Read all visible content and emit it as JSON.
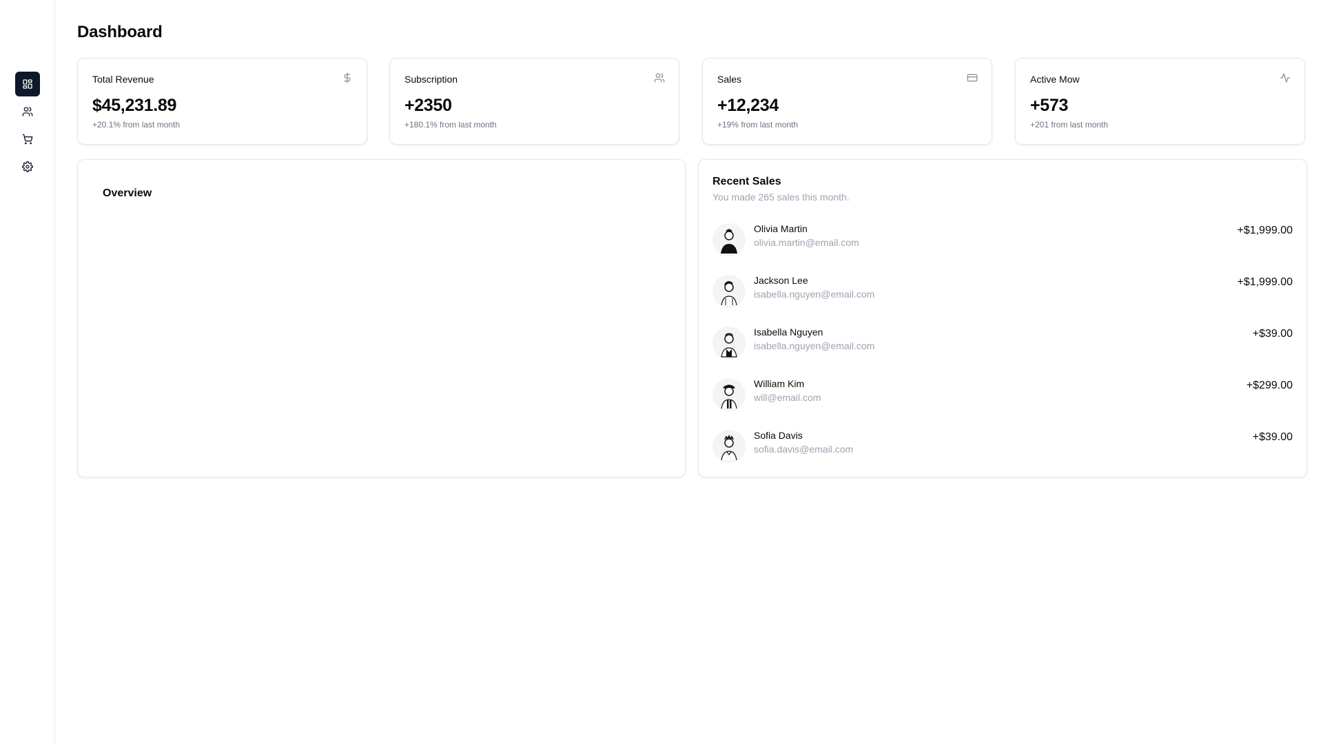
{
  "page": {
    "title": "Dashboard"
  },
  "sidebar": {
    "items": [
      {
        "icon": "dashboard-icon",
        "active": true
      },
      {
        "icon": "users-icon",
        "active": false
      },
      {
        "icon": "cart-icon",
        "active": false
      },
      {
        "icon": "settings-icon",
        "active": false
      }
    ]
  },
  "stats": [
    {
      "label": "Total Revenue",
      "value": "$45,231.89",
      "sub": "+20.1% from last month",
      "icon": "dollar-icon"
    },
    {
      "label": "Subscription",
      "value": "+2350",
      "sub": "+180.1% from last month",
      "icon": "users-icon"
    },
    {
      "label": "Sales",
      "value": "+12,234",
      "sub": "+19% from last month",
      "icon": "credit-card-icon"
    },
    {
      "label": "Active Mow",
      "value": "+573",
      "sub": "+201 from last month",
      "icon": "activity-icon"
    }
  ],
  "overview": {
    "title": "Overview"
  },
  "recent_sales": {
    "title": "Recent Sales",
    "description": "You made 265 sales this month.",
    "items": [
      {
        "name": "Olivia Martin",
        "email": "olivia.martin@email.com",
        "amount": "+$1,999.00"
      },
      {
        "name": "Jackson Lee",
        "email": "isabella.nguyen@email.com",
        "amount": "+$1,999.00"
      },
      {
        "name": "Isabella Nguyen",
        "email": "isabella.nguyen@email.com",
        "amount": "+$39.00"
      },
      {
        "name": "William Kim",
        "email": "will@email.com",
        "amount": "+$299.00"
      },
      {
        "name": "Sofia Davis",
        "email": "sofia.davis@email.com",
        "amount": "+$39.00"
      }
    ]
  },
  "colors": {
    "accent": "#0f172a",
    "muted": "#9ca3af",
    "border": "#e5e7eb"
  }
}
